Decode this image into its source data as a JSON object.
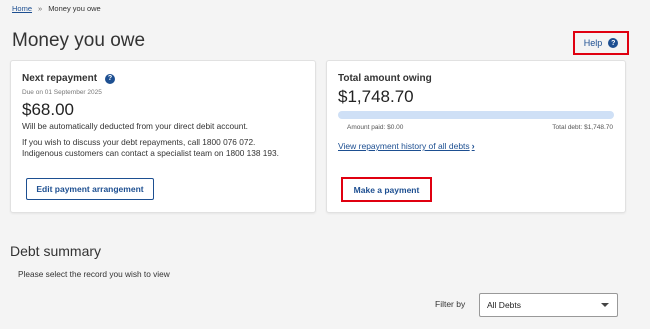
{
  "breadcrumb": {
    "home": "Home",
    "separator": "»",
    "current": "Money you owe"
  },
  "page": {
    "title": "Money you owe"
  },
  "help": {
    "label": "Help",
    "icon": "question-circle-icon",
    "icon_glyph": "?"
  },
  "next_repayment": {
    "title": "Next repayment",
    "info_icon": "?",
    "due": "Due on 01 September 2025",
    "amount": "$68.00",
    "auto_deduct": "Will be automatically deducted from your direct debit account.",
    "discuss_line1": "If you wish to discuss your debt repayments, call 1800 076 072.",
    "discuss_line2": "Indigenous customers can contact a specialist team on 1800 138 193.",
    "edit_button": "Edit payment arrangement"
  },
  "total_owing": {
    "title": "Total amount owing",
    "amount": "$1,748.70",
    "paid_fraction": 0,
    "amount_paid": "Amount paid: $0.00",
    "total_debt": "Total debt: $1,748.70",
    "history_link": "View repayment history of all debts",
    "history_chevron": "›",
    "pay_button": "Make a payment"
  },
  "debt_summary": {
    "title": "Debt summary",
    "subtitle": "Please select the record you wish to view",
    "filter_label": "Filter by",
    "filter_value": "All Debts"
  },
  "colors": {
    "accent": "#1d4f91",
    "highlight": "#e00010",
    "progress_track": "#cfe0f6"
  }
}
